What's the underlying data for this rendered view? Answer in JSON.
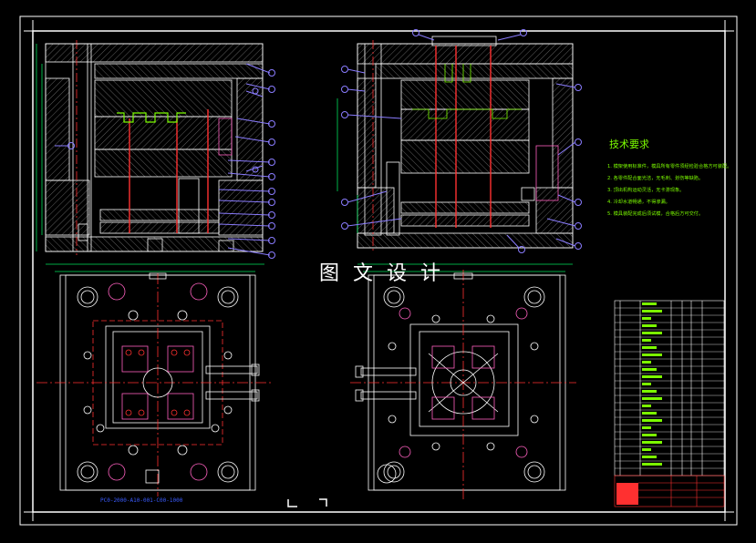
{
  "watermark": "图 文 设 计",
  "technical_requirements": {
    "title": "技术要求",
    "items": [
      "1. 模架使用标准件，模具所有零件须经检验合格方可装配。",
      "2. 各零件配合面光洁，无毛刺、划伤等缺陷。",
      "3. 顶出机构运动灵活，无卡滞现象。",
      "4. 冷却水道畅通，不得渗漏。",
      "5. 模具装配完成后须试模，合格后方可交付。"
    ]
  },
  "bottom_note": "PC0-2000-A10-001-C00-1000",
  "balloon_color": "#8a7cff",
  "line_color": "#ffffff",
  "dimension_color": "#00e05a",
  "ejector_color": "#ff3030",
  "cavity_color": "#ff60c0"
}
